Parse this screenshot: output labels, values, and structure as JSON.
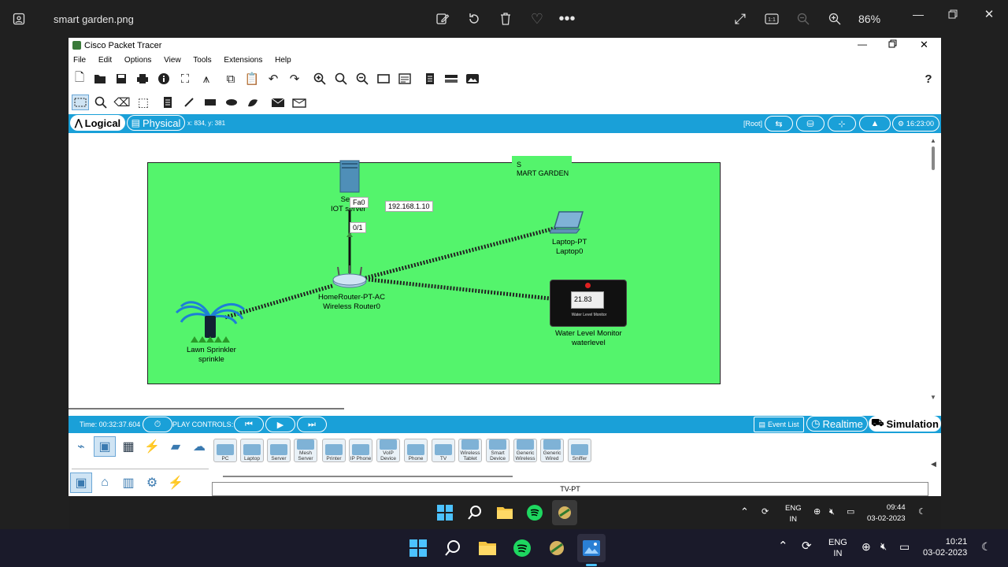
{
  "viewer": {
    "file_name": "smart garden.png",
    "zoom": "86%",
    "icons": [
      "gallery-icon",
      "edit-icon",
      "rotate-icon",
      "delete-icon",
      "favorite-icon",
      "more-icon",
      "fullscreen-icon",
      "actual-size-icon",
      "zoom-out-icon",
      "zoom-in-icon",
      "minimize-icon",
      "restore-icon",
      "close-icon"
    ]
  },
  "pt": {
    "title": "Cisco Packet Tracer",
    "menu": [
      "File",
      "Edit",
      "Options",
      "View",
      "Tools",
      "Extensions",
      "Help"
    ],
    "help_icon": "?",
    "modes": {
      "logical": "Logical",
      "physical": "Physical",
      "coords": "x: 834, y: 381"
    },
    "root": "[Root]",
    "clock": "16:23:00",
    "workspace": {
      "note_line1": "S",
      "note_line2": "MART GARDEN",
      "ip_label": "192.168.1.10",
      "port_fa0": "Fa0",
      "port_01": "0/1",
      "server": {
        "line1": "Serv",
        "line2": "IOT server"
      },
      "router": {
        "line1": "HomeRouter-PT-AC",
        "line2": "Wireless Router0"
      },
      "laptop": {
        "line1": "Laptop-PT",
        "line2": "Laptop0"
      },
      "monitor": {
        "reading": "21.83",
        "caption": "Water Level Monitor",
        "line1": "Water Level Monitor",
        "line2": "waterlevel"
      },
      "sprinkler": {
        "line1": "Lawn Sprinkler",
        "line2": "sprinkle"
      }
    },
    "simbar": {
      "time": "Time: 00:32:37.604",
      "play_controls": "PLAY CONTROLS:",
      "event_list": "Event List",
      "realtime": "Realtime",
      "simulation": "Simulation"
    },
    "devices": [
      "PC",
      "Laptop",
      "Server",
      "Mesh Server",
      "Printer",
      "IP Phone",
      "VoIP Device",
      "Phone",
      "TV",
      "Wireless Tablet",
      "Smart Device",
      "Generic Wireless",
      "Generic Wired",
      "Sniffer"
    ],
    "selected_device": "TV-PT"
  },
  "taskbar_inner": {
    "lang1": "ENG",
    "lang2": "IN",
    "time": "09:44",
    "date": "03-02-2023"
  },
  "taskbar_outer": {
    "lang1": "ENG",
    "lang2": "IN",
    "time": "10:21",
    "date": "03-02-2023"
  }
}
